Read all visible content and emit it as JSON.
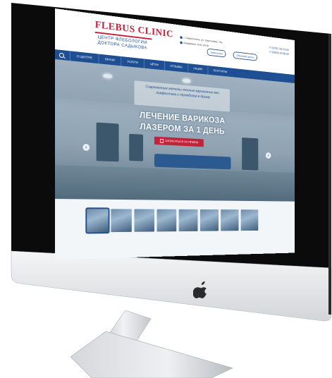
{
  "site": {
    "logo_title": "FLEBUS CLINIC",
    "logo_sub1": "ЦЕНТР ФЛЕБОЛОГИИ",
    "logo_sub2": "ДОКТОРА САДЫКОВА",
    "address": "г. Севастополь, ул. Хрусталёва, 74а",
    "hours": "Ежедневно: 8.00–20.00",
    "pill_1": "Записаться",
    "pill_2": "Обратный звонок",
    "phone_1": "+7 (978) 723-72-62",
    "phone_2": "+7 (8692) 40-88-99"
  },
  "nav": {
    "items": [
      "О ЦЕНТРЕ",
      "ВРАЧИ",
      "УСЛУГИ",
      "ЦЕНЫ",
      "ОТЗЫВЫ",
      "АКЦИИ",
      "КОНТАКТЫ"
    ]
  },
  "hero": {
    "panel_text": "Современные методы лечения варикозных вен, лимфостаза и тромбозов в Крыму",
    "headline_1": "ЛЕЧЕНИЕ ВАРИКОЗА",
    "headline_2": "ЛАЗЕРОМ ЗА 1 ДЕНЬ",
    "cta": "ЗАПИСАТЬСЯ НА ПРИЕМ",
    "prev": "‹",
    "next": "›"
  },
  "colors": {
    "brand_red": "#c2223a",
    "brand_blue": "#1f4f93"
  },
  "icons": {
    "device_logo": "apple-icon"
  }
}
